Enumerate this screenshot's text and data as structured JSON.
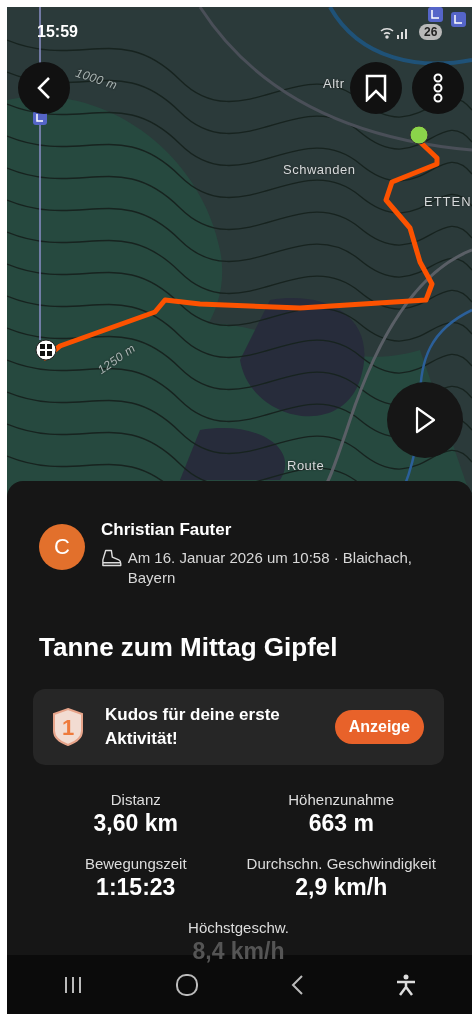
{
  "status_bar": {
    "time": "15:59",
    "battery": "26"
  },
  "map": {
    "labels": [
      {
        "text": "1000 m",
        "kind": "contour"
      },
      {
        "text": "Altr",
        "kind": "place"
      },
      {
        "text": "Schwanden",
        "kind": "place"
      },
      {
        "text": "ETTEN",
        "kind": "district"
      },
      {
        "text": "1250 m",
        "kind": "contour"
      },
      {
        "text": "Route",
        "kind": "place"
      }
    ]
  },
  "athlete": {
    "initial": "C",
    "name": "Christian Fauter",
    "meta": "Am 16. Januar 2026 um 10:58 · Blaichach, Bayern"
  },
  "title": "Tanne zum Mittag Gipfel",
  "kudos": {
    "badge": "1",
    "text": "Kudos für deine erste Aktivität!",
    "button": "Anzeige"
  },
  "stats": [
    {
      "label": "Distanz",
      "value": "3,60 km",
      "dimmed": false
    },
    {
      "label": "Höhenzunahme",
      "value": "663 m",
      "dimmed": false
    },
    {
      "label": "Bewegungszeit",
      "value": "1:15:23",
      "dimmed": false
    },
    {
      "label": "Durchschn. Geschwindigkeit",
      "value": "2,9 km/h",
      "dimmed": false
    },
    {
      "label": "Höchstgeschw.",
      "value": "8,4 km/h",
      "dimmed": true
    }
  ]
}
